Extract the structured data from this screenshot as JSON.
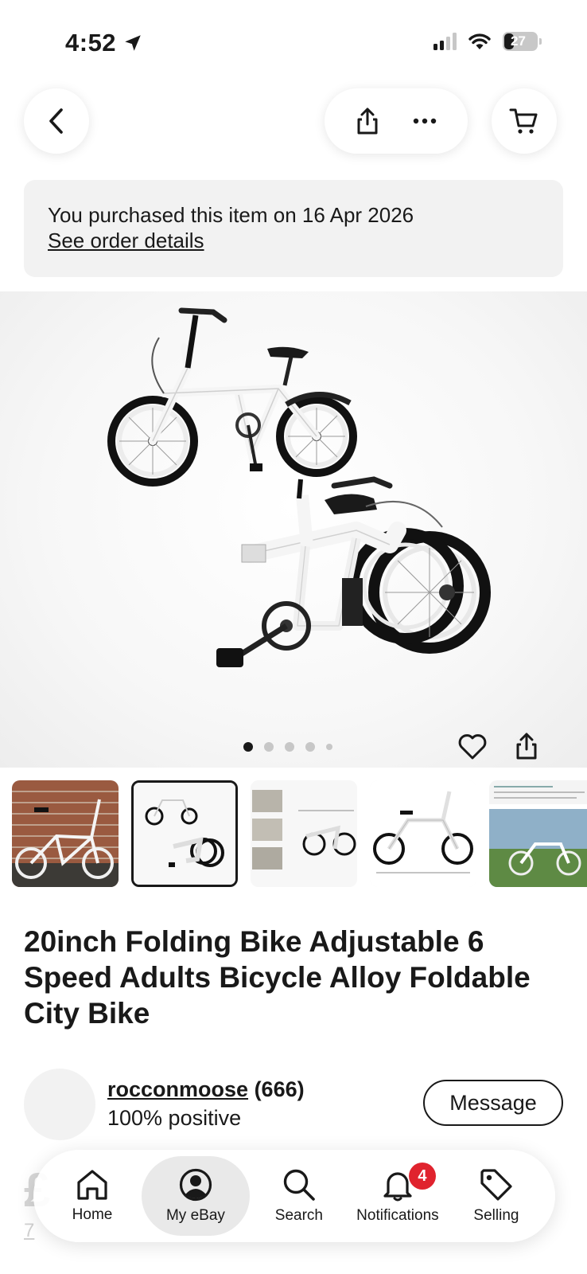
{
  "status_bar": {
    "time": "4:52",
    "battery": "27"
  },
  "banner": {
    "text": "You purchased this item on 16 Apr 2026",
    "link": "See order details"
  },
  "gallery": {
    "total_images": 5,
    "active_index": 0
  },
  "listing": {
    "title": "20inch Folding Bike Adjustable 6 Speed Adults Bicycle Alloy Foldable City Bike"
  },
  "seller": {
    "name": "rocconmoose",
    "feedback_count": "(666)",
    "positive": "100% positive",
    "message_label": "Message"
  },
  "nav": {
    "items": [
      {
        "label": "Home",
        "icon": "home-icon"
      },
      {
        "label": "My eBay",
        "icon": "account-icon"
      },
      {
        "label": "Search",
        "icon": "search-icon"
      },
      {
        "label": "Notifications",
        "icon": "bell-icon"
      },
      {
        "label": "Selling",
        "icon": "tag-icon"
      }
    ],
    "active": "My eBay",
    "notification_count": "4"
  },
  "colors": {
    "text": "#191919",
    "badge": "#e0232e",
    "banner_bg": "#f2f2f2"
  }
}
